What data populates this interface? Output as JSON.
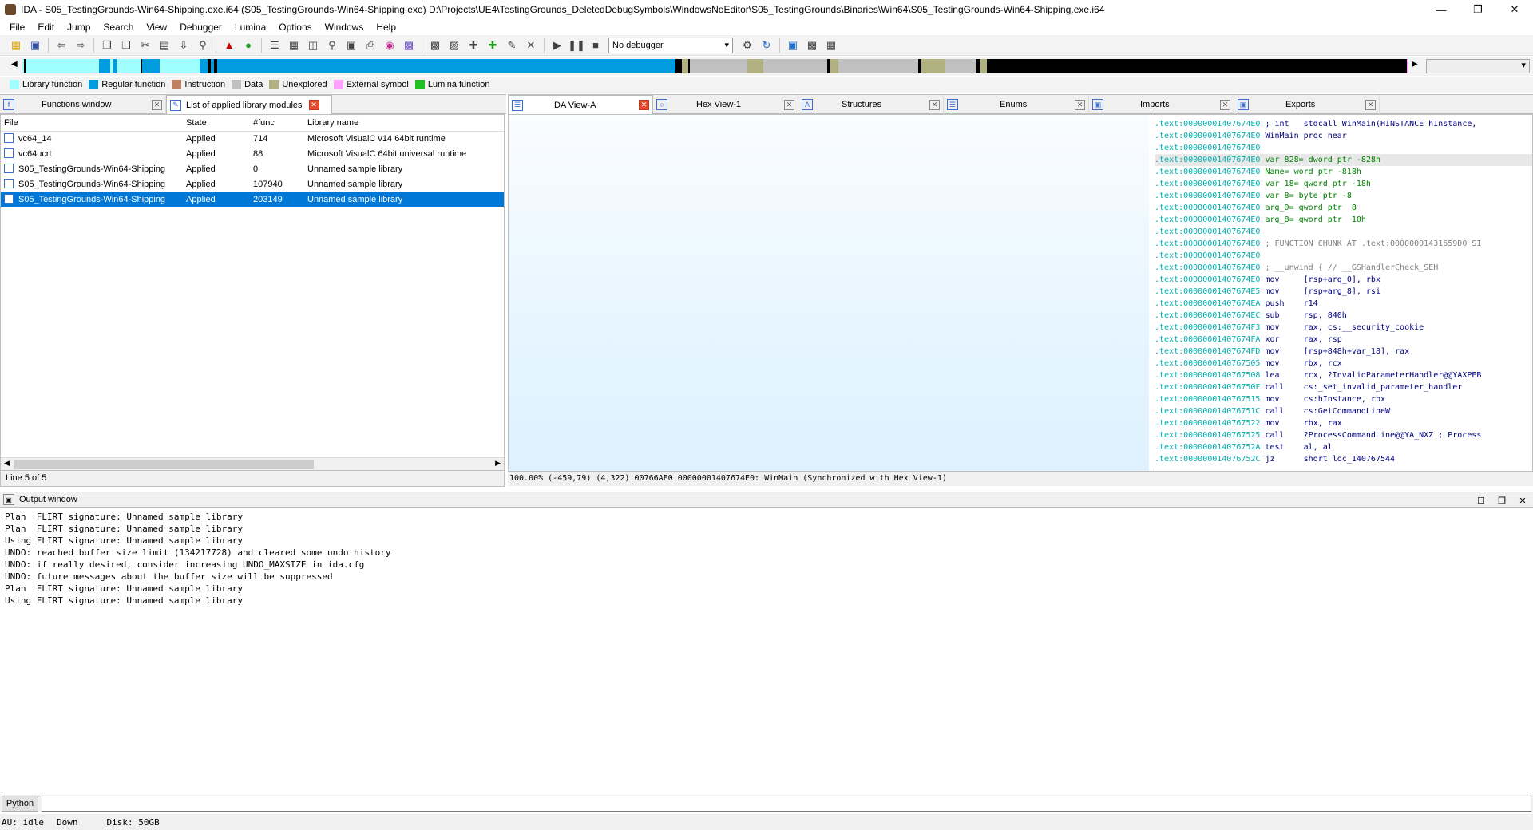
{
  "window": {
    "title": "IDA - S05_TestingGrounds-Win64-Shipping.exe.i64 (S05_TestingGrounds-Win64-Shipping.exe) D:\\Projects\\UE4\\TestingGrounds_DeletedDebugSymbols\\WindowsNoEditor\\S05_TestingGrounds\\Binaries\\Win64\\S05_TestingGrounds-Win64-Shipping.exe.i64",
    "minimize": "—",
    "maximize": "❐",
    "close": "✕"
  },
  "menu": [
    "File",
    "Edit",
    "Jump",
    "Search",
    "View",
    "Debugger",
    "Lumina",
    "Options",
    "Windows",
    "Help"
  ],
  "toolbar": {
    "debugger_select": "No debugger"
  },
  "legend": [
    {
      "label": "Library function",
      "color": "#a0ffff"
    },
    {
      "label": "Regular function",
      "color": "#009cdf"
    },
    {
      "label": "Instruction",
      "color": "#c08060"
    },
    {
      "label": "Data",
      "color": "#c0c0c0"
    },
    {
      "label": "Unexplored",
      "color": "#b0b080"
    },
    {
      "label": "External symbol",
      "color": "#ffa0ff"
    },
    {
      "label": "Lumina function",
      "color": "#20c020"
    }
  ],
  "left_tabs": [
    {
      "label": "Functions window",
      "active": false
    },
    {
      "label": "List of applied library modules",
      "active": true
    }
  ],
  "lib_table": {
    "headers": [
      "File",
      "State",
      "#func",
      "Library name"
    ],
    "rows": [
      {
        "file": "vc64_14",
        "state": "Applied",
        "nfunc": "714",
        "name": "Microsoft VisualC v14 64bit runtime",
        "selected": false
      },
      {
        "file": "vc64ucrt",
        "state": "Applied",
        "nfunc": "88",
        "name": "Microsoft VisualC 64bit universal runtime",
        "selected": false
      },
      {
        "file": "S05_TestingGrounds-Win64-Shipping",
        "state": "Applied",
        "nfunc": "0",
        "name": "Unnamed sample library",
        "selected": false
      },
      {
        "file": "S05_TestingGrounds-Win64-Shipping",
        "state": "Applied",
        "nfunc": "107940",
        "name": "Unnamed sample library",
        "selected": false
      },
      {
        "file": "S05_TestingGrounds-Win64-Shipping",
        "state": "Applied",
        "nfunc": "203149",
        "name": "Unnamed sample library",
        "selected": true
      }
    ],
    "status": "Line 5 of 5"
  },
  "right_tabs": [
    {
      "label": "IDA View-A",
      "active": true
    },
    {
      "label": "Hex View-1",
      "active": false
    },
    {
      "label": "Structures",
      "active": false
    },
    {
      "label": "Enums",
      "active": false
    },
    {
      "label": "Imports",
      "active": false
    },
    {
      "label": "Exports",
      "active": false
    }
  ],
  "asm": [
    {
      "addr": ".text:00000001407674E0",
      "rest": " ; int __stdcall WinMain(HINSTANCE hInstance,",
      "cls": "mn",
      "hl": false
    },
    {
      "addr": ".text:00000001407674E0",
      "rest": " WinMain proc near",
      "cls": "op",
      "hl": false
    },
    {
      "addr": ".text:00000001407674E0",
      "rest": "",
      "cls": "op",
      "hl": false
    },
    {
      "addr": ".text:00000001407674E0",
      "rest": " var_828= dword ptr -828h",
      "cls": "nm",
      "hl": true
    },
    {
      "addr": ".text:00000001407674E0",
      "rest": " Name= word ptr -818h",
      "cls": "nm",
      "hl": false
    },
    {
      "addr": ".text:00000001407674E0",
      "rest": " var_18= qword ptr -18h",
      "cls": "nm",
      "hl": false
    },
    {
      "addr": ".text:00000001407674E0",
      "rest": " var_8= byte ptr -8",
      "cls": "nm",
      "hl": false
    },
    {
      "addr": ".text:00000001407674E0",
      "rest": " arg_0= qword ptr  8",
      "cls": "nm",
      "hl": false
    },
    {
      "addr": ".text:00000001407674E0",
      "rest": " arg_8= qword ptr  10h",
      "cls": "nm",
      "hl": false
    },
    {
      "addr": ".text:00000001407674E0",
      "rest": "",
      "cls": "op",
      "hl": false
    },
    {
      "addr": ".text:00000001407674E0",
      "rest": " ; FUNCTION CHUNK AT .text:00000001431659D0 SI",
      "cls": "cm",
      "hl": false
    },
    {
      "addr": ".text:00000001407674E0",
      "rest": "",
      "cls": "op",
      "hl": false
    },
    {
      "addr": ".text:00000001407674E0",
      "rest": " ; __unwind { // __GSHandlerCheck_SEH",
      "cls": "cm",
      "hl": false
    },
    {
      "addr": ".text:00000001407674E0",
      "rest": " mov     [rsp+arg_0], rbx",
      "cls": "op",
      "hl": false
    },
    {
      "addr": ".text:00000001407674E5",
      "rest": " mov     [rsp+arg_8], rsi",
      "cls": "op",
      "hl": false
    },
    {
      "addr": ".text:00000001407674EA",
      "rest": " push    r14",
      "cls": "op",
      "hl": false
    },
    {
      "addr": ".text:00000001407674EC",
      "rest": " sub     rsp, 840h",
      "cls": "op",
      "hl": false
    },
    {
      "addr": ".text:00000001407674F3",
      "rest": " mov     rax, cs:__security_cookie",
      "cls": "op",
      "hl": false
    },
    {
      "addr": ".text:00000001407674FA",
      "rest": " xor     rax, rsp",
      "cls": "op",
      "hl": false
    },
    {
      "addr": ".text:00000001407674FD",
      "rest": " mov     [rsp+848h+var_18], rax",
      "cls": "op",
      "hl": false
    },
    {
      "addr": ".text:0000000140767505",
      "rest": " mov     rbx, rcx",
      "cls": "op",
      "hl": false
    },
    {
      "addr": ".text:0000000140767508",
      "rest": " lea     rcx, ?InvalidParameterHandler@@YAXPEB",
      "cls": "op",
      "hl": false
    },
    {
      "addr": ".text:000000014076750F",
      "rest": " call    cs:_set_invalid_parameter_handler",
      "cls": "op",
      "hl": false
    },
    {
      "addr": ".text:0000000140767515",
      "rest": " mov     cs:hInstance, rbx",
      "cls": "op",
      "hl": false
    },
    {
      "addr": ".text:000000014076751C",
      "rest": " call    cs:GetCommandLineW",
      "cls": "op",
      "hl": false
    },
    {
      "addr": ".text:0000000140767522",
      "rest": " mov     rbx, rax",
      "cls": "op",
      "hl": false
    },
    {
      "addr": ".text:0000000140767525",
      "rest": " call    ?ProcessCommandLine@@YA_NXZ ; Process",
      "cls": "op",
      "hl": false
    },
    {
      "addr": ".text:000000014076752A",
      "rest": " test    al, al",
      "cls": "op",
      "hl": false
    },
    {
      "addr": ".text:000000014076752C",
      "rest": " jz      short loc_140767544",
      "cls": "op",
      "hl": false
    }
  ],
  "ida_status": "100.00% (-459,79) (4,322) 00766AE0 00000001407674E0: WinMain (Synchronized with Hex View-1)",
  "output": {
    "title": "Output window",
    "lines": [
      "Plan  FLIRT signature: Unnamed sample library",
      "Plan  FLIRT signature: Unnamed sample library",
      "Using FLIRT signature: Unnamed sample library",
      "UNDO: reached buffer size limit (134217728) and cleared some undo history",
      "UNDO: if really desired, consider increasing UNDO_MAXSIZE in ida.cfg",
      "UNDO: future messages about the buffer size will be suppressed",
      "Plan  FLIRT signature: Unnamed sample library",
      "Using FLIRT signature: Unnamed sample library"
    ]
  },
  "python_button": "Python",
  "status": {
    "au": "AU:  idle",
    "dir": "Down",
    "disk": "Disk: 50GB"
  }
}
